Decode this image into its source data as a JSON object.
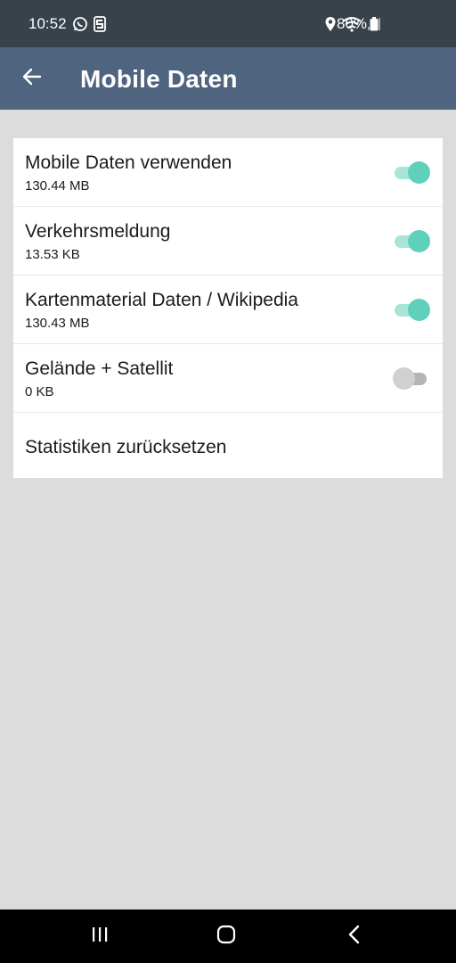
{
  "status_bar": {
    "time": "10:52",
    "battery": "80%",
    "icons": [
      "whatsapp-icon",
      "s-app-icon",
      "location-icon",
      "wifi-icon",
      "signal-icon",
      "battery-icon"
    ]
  },
  "app_bar": {
    "title": "Mobile Daten",
    "back_icon": "arrow-left-icon"
  },
  "settings": {
    "items": [
      {
        "title": "Mobile Daten verwenden",
        "value": "130.44 MB",
        "enabled": true
      },
      {
        "title": "Verkehrsmeldung",
        "value": "13.53 KB",
        "enabled": true
      },
      {
        "title": "Kartenmaterial Daten / Wikipedia",
        "value": "130.43 MB",
        "enabled": true
      },
      {
        "title": "Gelände + Satellit",
        "value": "0 KB",
        "enabled": false
      }
    ],
    "reset_label": "Statistiken zurücksetzen"
  },
  "nav_bar": {
    "icons": [
      "recents-icon",
      "home-icon",
      "back-icon"
    ]
  },
  "colors": {
    "status_bar": "#37424b",
    "app_bar": "#4e647f",
    "background": "#dcdcdc",
    "toggle_on": "#5fd0bc",
    "toggle_off": "#d0d0d0"
  }
}
